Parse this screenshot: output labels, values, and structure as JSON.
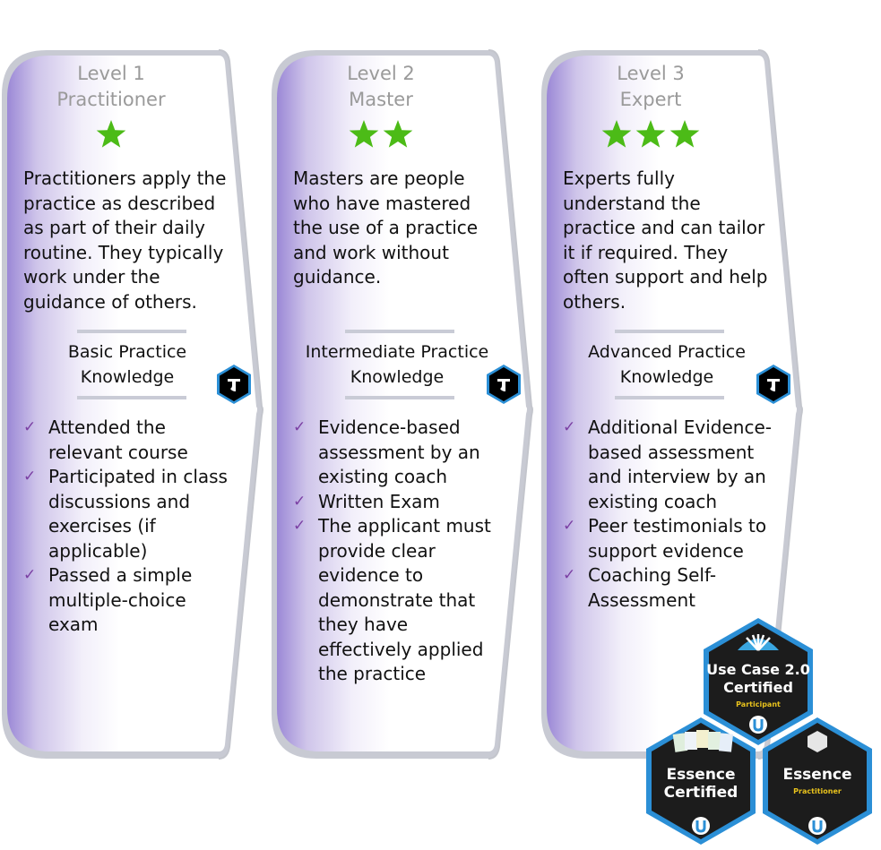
{
  "colors": {
    "accent_purple": "#9b88d6",
    "border_gray": "#c8cad3",
    "star_green": "#4cbb17",
    "check_purple": "#7b3fa3",
    "badge_blue": "#2b8fd6",
    "badge_dark": "#1c1c1c",
    "badge_gold": "#e8c21c"
  },
  "levels": [
    {
      "level": "Level 1",
      "name": "Practitioner",
      "stars": 1,
      "star_icon": "star-icon",
      "description": "Practitioners apply the practice as described as part of their daily routine.  They typically work under the guidance of others.",
      "knowledge_line1": "Basic Practice",
      "knowledge_line2": "Knowledge",
      "knowledge_icon": "ivar-jacobson-badge-icon",
      "checks": [
        "Attended the relevant course",
        "Participated in class discussions and exercises (if applicable)",
        "Passed a simple multiple-choice exam"
      ]
    },
    {
      "level": "Level 2",
      "name": "Master",
      "stars": 2,
      "star_icon": "star-icon",
      "description": "Masters are people who have mastered the use of a practice and work without guidance.",
      "knowledge_line1": "Intermediate Practice",
      "knowledge_line2": "Knowledge",
      "knowledge_icon": "ivar-jacobson-badge-icon",
      "checks": [
        "Evidence-based assessment by an existing coach",
        "Written Exam",
        "The applicant must provide clear evidence to demonstrate that they have effectively applied the practice"
      ]
    },
    {
      "level": "Level 3",
      "name": "Expert",
      "stars": 3,
      "star_icon": "star-icon",
      "description": "Experts fully understand the practice and can tailor it if required.  They often support and help others.",
      "knowledge_line1": "Advanced Practice",
      "knowledge_line2": "Knowledge",
      "knowledge_icon": "ivar-jacobson-badge-icon",
      "checks": [
        "Additional Evidence-based assessment and interview by an existing coach",
        "Peer testimonials to support evidence",
        "Coaching Self-Assessment"
      ]
    }
  ],
  "badges": [
    {
      "line1": "Use Case 2.0",
      "line2": "Certified",
      "sub": "Participant",
      "icon": "use-case-fan-icon"
    },
    {
      "line1": "Essence",
      "line2": "Certified",
      "sub": "",
      "icon": "essence-cards-icon"
    },
    {
      "line1": "Essence",
      "line2": "",
      "sub": "Practitioner",
      "icon": "hexagon-icon"
    }
  ],
  "check_glyph": "✓"
}
